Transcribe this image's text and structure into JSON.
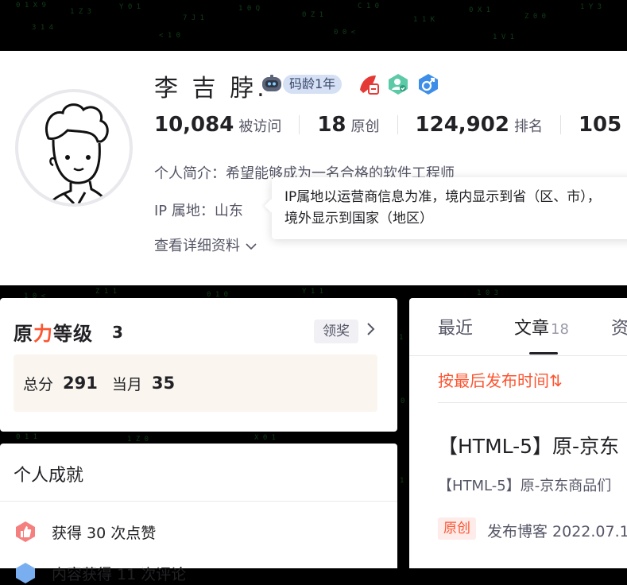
{
  "profile": {
    "name": "李 吉 脖.",
    "code_age": "码龄1年",
    "stats": [
      {
        "value": "10,084",
        "label": "被访问"
      },
      {
        "value": "18",
        "label": "原创"
      },
      {
        "value": "124,902",
        "label": "排名"
      },
      {
        "value": "105",
        "label": ""
      }
    ],
    "bio": "个人简介：希望能够成为一名合格的软件工程师",
    "ip_location": "IP 属地：山东",
    "more_info": "查看详细资料",
    "tooltip_line1": "IP属地以运营商信息为准，境内显示到省（区、市），",
    "tooltip_line2": "境外显示到国家（地区）"
  },
  "level": {
    "logo_left": "原",
    "logo_mid": "力",
    "logo_right": "等级",
    "level_num": "3",
    "claim_label": "领奖",
    "total_label": "总分",
    "total_value": "291",
    "month_label": "当月",
    "month_value": "35"
  },
  "achievements": {
    "title": "个人成就",
    "items": [
      {
        "text": "获得 30 次点赞"
      },
      {
        "text": "内容获得 11 次评论"
      }
    ]
  },
  "articles": {
    "tabs": [
      {
        "label": "最近",
        "count": ""
      },
      {
        "label": "文章",
        "count": "18"
      },
      {
        "label": "资",
        "count": ""
      }
    ],
    "sort_label": "按最后发布时间⇅",
    "first_title": "【HTML-5】原-京东",
    "first_desc": "【HTML-5】原-京东商品们",
    "original_tag": "原创",
    "first_meta": "发布博客 2022.07.1"
  },
  "colors": {
    "accent": "#fc5531",
    "matrix_green": "#1f6e2a",
    "level_box_bg": "#faf6ef",
    "pill_bg": "#d5e0f5"
  },
  "icons": [
    "robot-badge-icon",
    "red-medal-icon",
    "user-check-medal-icon",
    "male-icon",
    "chevron-down-icon",
    "chevron-right-icon",
    "thumbs-up-icon",
    "comment-icon"
  ]
}
